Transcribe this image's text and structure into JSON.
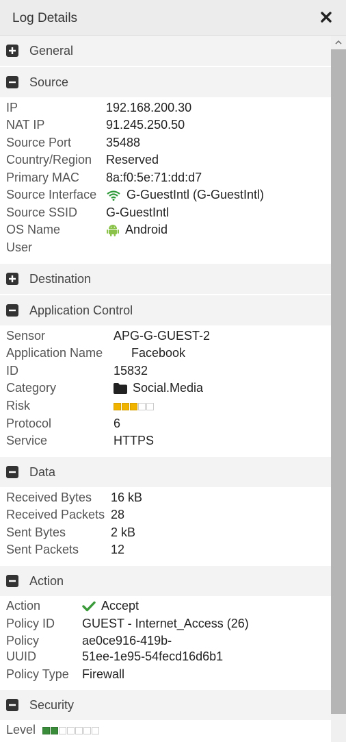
{
  "header": {
    "title": "Log Details",
    "close_icon": "close-icon"
  },
  "colors": {
    "wifi": "#2f9a3a",
    "android": "#8bc34a",
    "check": "#3a9a3a",
    "risk": "#f0b400",
    "level": "#3a8c3a"
  },
  "sections": {
    "general": {
      "label": "General",
      "state": "collapsed"
    },
    "source": {
      "label": "Source",
      "state": "expanded",
      "ip_label": "IP",
      "ip": "192.168.200.30",
      "nat_ip_label": "NAT IP",
      "nat_ip": "91.245.250.50",
      "source_port_label": "Source Port",
      "source_port": "35488",
      "country_label": "Country/Region",
      "country": "Reserved",
      "mac_label": "Primary MAC",
      "mac": "8a:f0:5e:71:dd:d7",
      "interface_label": "Source Interface",
      "interface": "G-GuestIntl (G-GuestIntl)",
      "ssid_label": "Source SSID",
      "ssid": "G-GuestIntl",
      "os_label": "OS Name",
      "os": "Android",
      "user_label": "User"
    },
    "destination": {
      "label": "Destination",
      "state": "collapsed"
    },
    "app_control": {
      "label": "Application Control",
      "state": "expanded",
      "sensor_label": "Sensor",
      "sensor": "APG-G-GUEST-2",
      "app_name_label": "Application Name",
      "app_name": "Facebook",
      "id_label": "ID",
      "id": "15832",
      "category_label": "Category",
      "category": "Social.Media",
      "risk_label": "Risk",
      "risk_level": 3,
      "risk_max": 5,
      "protocol_label": "Protocol",
      "protocol": "6",
      "service_label": "Service",
      "service": "HTTPS"
    },
    "data": {
      "label": "Data",
      "state": "expanded",
      "rx_bytes_label": "Received Bytes",
      "rx_bytes": "16 kB",
      "rx_packets_label": "Received Packets",
      "rx_packets": "28",
      "tx_bytes_label": "Sent Bytes",
      "tx_bytes": "2 kB",
      "tx_packets_label": "Sent Packets",
      "tx_packets": "12"
    },
    "action": {
      "label": "Action",
      "state": "expanded",
      "action_label": "Action",
      "action": "Accept",
      "policy_id_label": "Policy ID",
      "policy_id": "GUEST - Internet_Access (26)",
      "policy_uuid_label_1": "Policy",
      "policy_uuid_label_2": "UUID",
      "policy_uuid_1": "ae0ce916-419b-",
      "policy_uuid_2": "51ee-1e95-54fecd16d6b1",
      "policy_type_label": "Policy Type",
      "policy_type": "Firewall"
    },
    "security": {
      "label": "Security",
      "state": "expanded",
      "level_label": "Level",
      "level": 2,
      "level_max": 7
    }
  }
}
